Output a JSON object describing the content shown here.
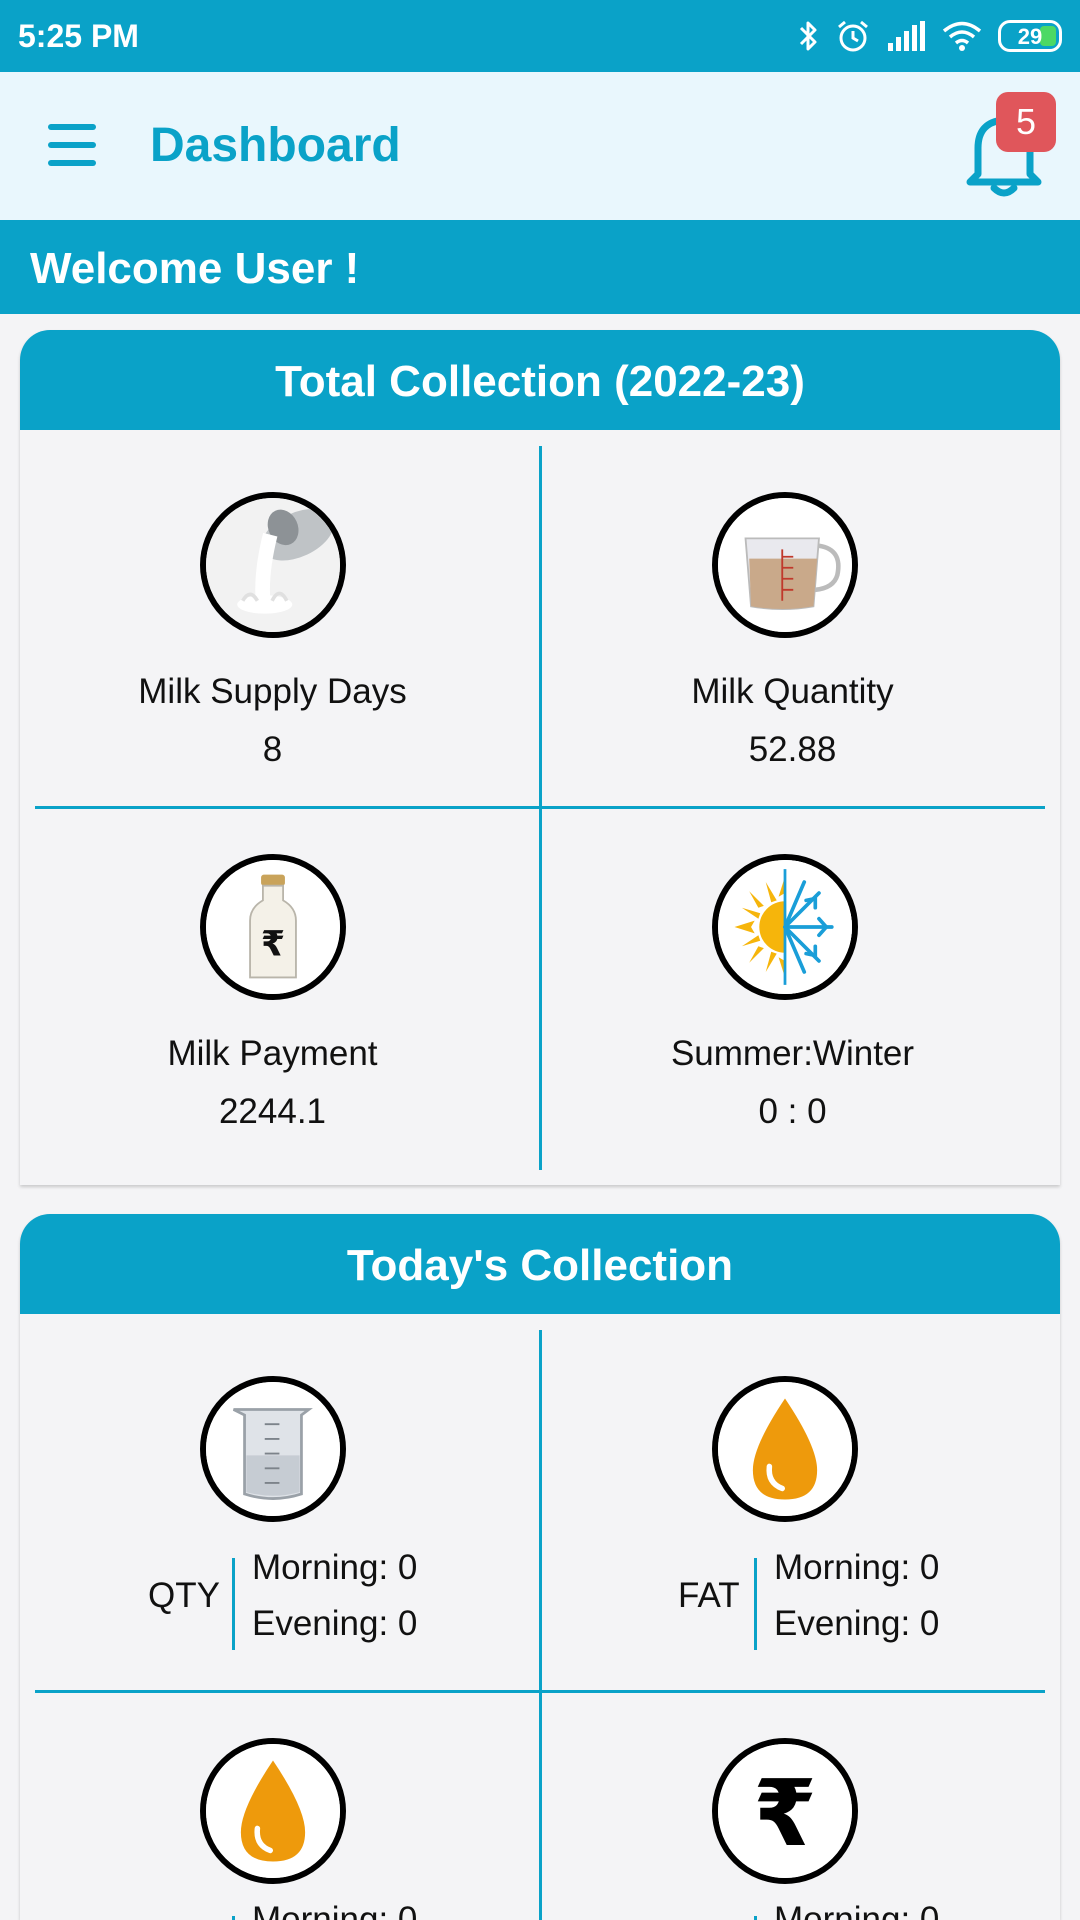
{
  "status_bar": {
    "time": "5:25 PM",
    "battery": "29"
  },
  "app_bar": {
    "title": "Dashboard",
    "notification_count": "5"
  },
  "welcome": "Welcome User !",
  "total_collection": {
    "title": "Total Collection (2022-23)",
    "items": [
      {
        "label": "Milk Supply Days",
        "value": "8",
        "icon": "milk-pour-icon"
      },
      {
        "label": "Milk Quantity",
        "value": "52.88",
        "icon": "measuring-cup-icon"
      },
      {
        "label": "Milk Payment",
        "value": "2244.1",
        "icon": "milk-bottle-rupee-icon"
      },
      {
        "label": "Summer:Winter",
        "value": "0 : 0",
        "icon": "sun-snowflake-icon"
      }
    ]
  },
  "todays_collection": {
    "title": "Today's Collection",
    "items": [
      {
        "label": "QTY",
        "morning": "Morning: 0",
        "evening": "Evening: 0",
        "icon": "beaker-icon"
      },
      {
        "label": "FAT",
        "morning": "Morning: 0",
        "evening": "Evening: 0",
        "icon": "oil-drop-icon"
      }
    ],
    "partial_items": [
      {
        "morning": "Morning: 0",
        "icon": "oil-drop-icon"
      },
      {
        "morning": "Morning: 0",
        "icon": "rupee-icon"
      }
    ]
  },
  "colors": {
    "primary": "#0aa2c8",
    "app_bar_bg": "#e9f7fd",
    "badge": "#e0565b",
    "drop": "#ee9a0c"
  }
}
